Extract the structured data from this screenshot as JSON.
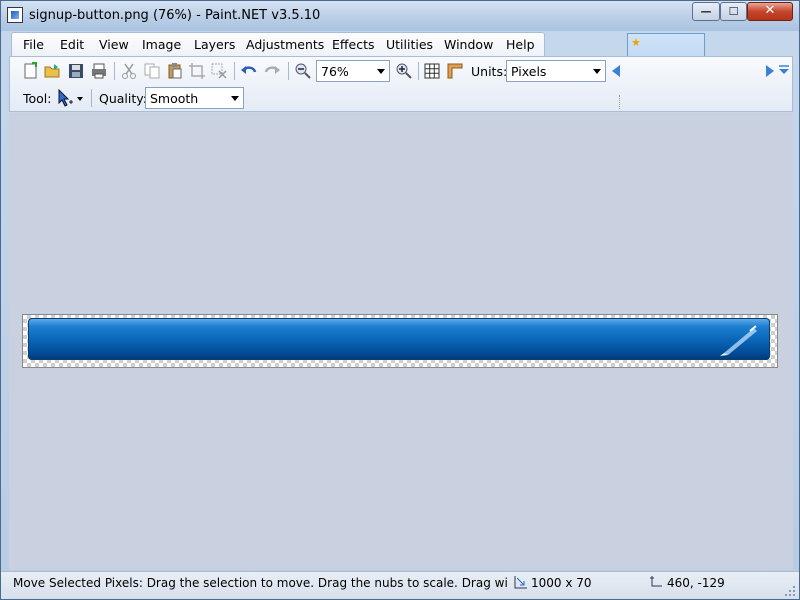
{
  "window": {
    "title": "signup-button.png (76%) - Paint.NET v3.5.10",
    "controls": {
      "minimize": "—",
      "maximize": "☐",
      "close": "✕"
    }
  },
  "menu": {
    "items": [
      {
        "label": "File"
      },
      {
        "label": "Edit"
      },
      {
        "label": "View"
      },
      {
        "label": "Image"
      },
      {
        "label": "Layers"
      },
      {
        "label": "Adjustments"
      },
      {
        "label": "Effects"
      },
      {
        "label": "Utilities"
      },
      {
        "label": "Window"
      },
      {
        "label": "Help"
      }
    ]
  },
  "toolbar": {
    "zoom_value": "76%",
    "units_label": "Units:",
    "units_value": "Pixels",
    "tool_label": "Tool:",
    "quality_label": "Quality:",
    "quality_value": "Smooth"
  },
  "status": {
    "message": "Move Selected Pixels: Drag the selection to move. Drag the nubs to scale. Drag with right mou",
    "image_size": "1000 x 70",
    "cursor_position": "460, -129"
  },
  "colors": {
    "accent": "#0a63b5",
    "canvas_bg": "#c9d1e1"
  }
}
